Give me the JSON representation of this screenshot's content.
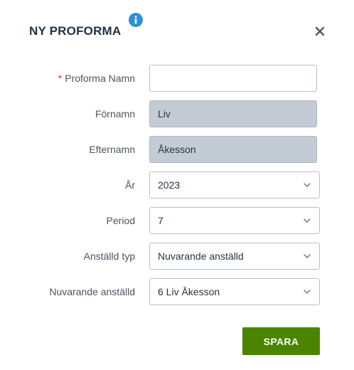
{
  "dialog": {
    "title": "NY PROFORMA",
    "info_icon": "info-icon",
    "close_icon": "close-icon"
  },
  "form": {
    "proforma_name": {
      "required_mark": "*",
      "label": "Proforma Namn",
      "value": ""
    },
    "first_name": {
      "label": "Förnamn",
      "value": "Liv"
    },
    "last_name": {
      "label": "Efternamn",
      "value": "Åkesson"
    },
    "year": {
      "label": "År",
      "selected": "2023"
    },
    "period": {
      "label": "Period",
      "selected": "7"
    },
    "employee_type": {
      "label": "Anställd typ",
      "selected": "Nuvarande anställd"
    },
    "current_employee": {
      "label": "Nuvarande anställd",
      "selected": "6 Liv Åkesson"
    }
  },
  "actions": {
    "save_label": "SPARA"
  },
  "colors": {
    "save_button": "#4a8400",
    "info_icon": "#2d90d3",
    "required": "#d0342c",
    "readonly_field": "#c3ccd5",
    "title": "#233243"
  }
}
